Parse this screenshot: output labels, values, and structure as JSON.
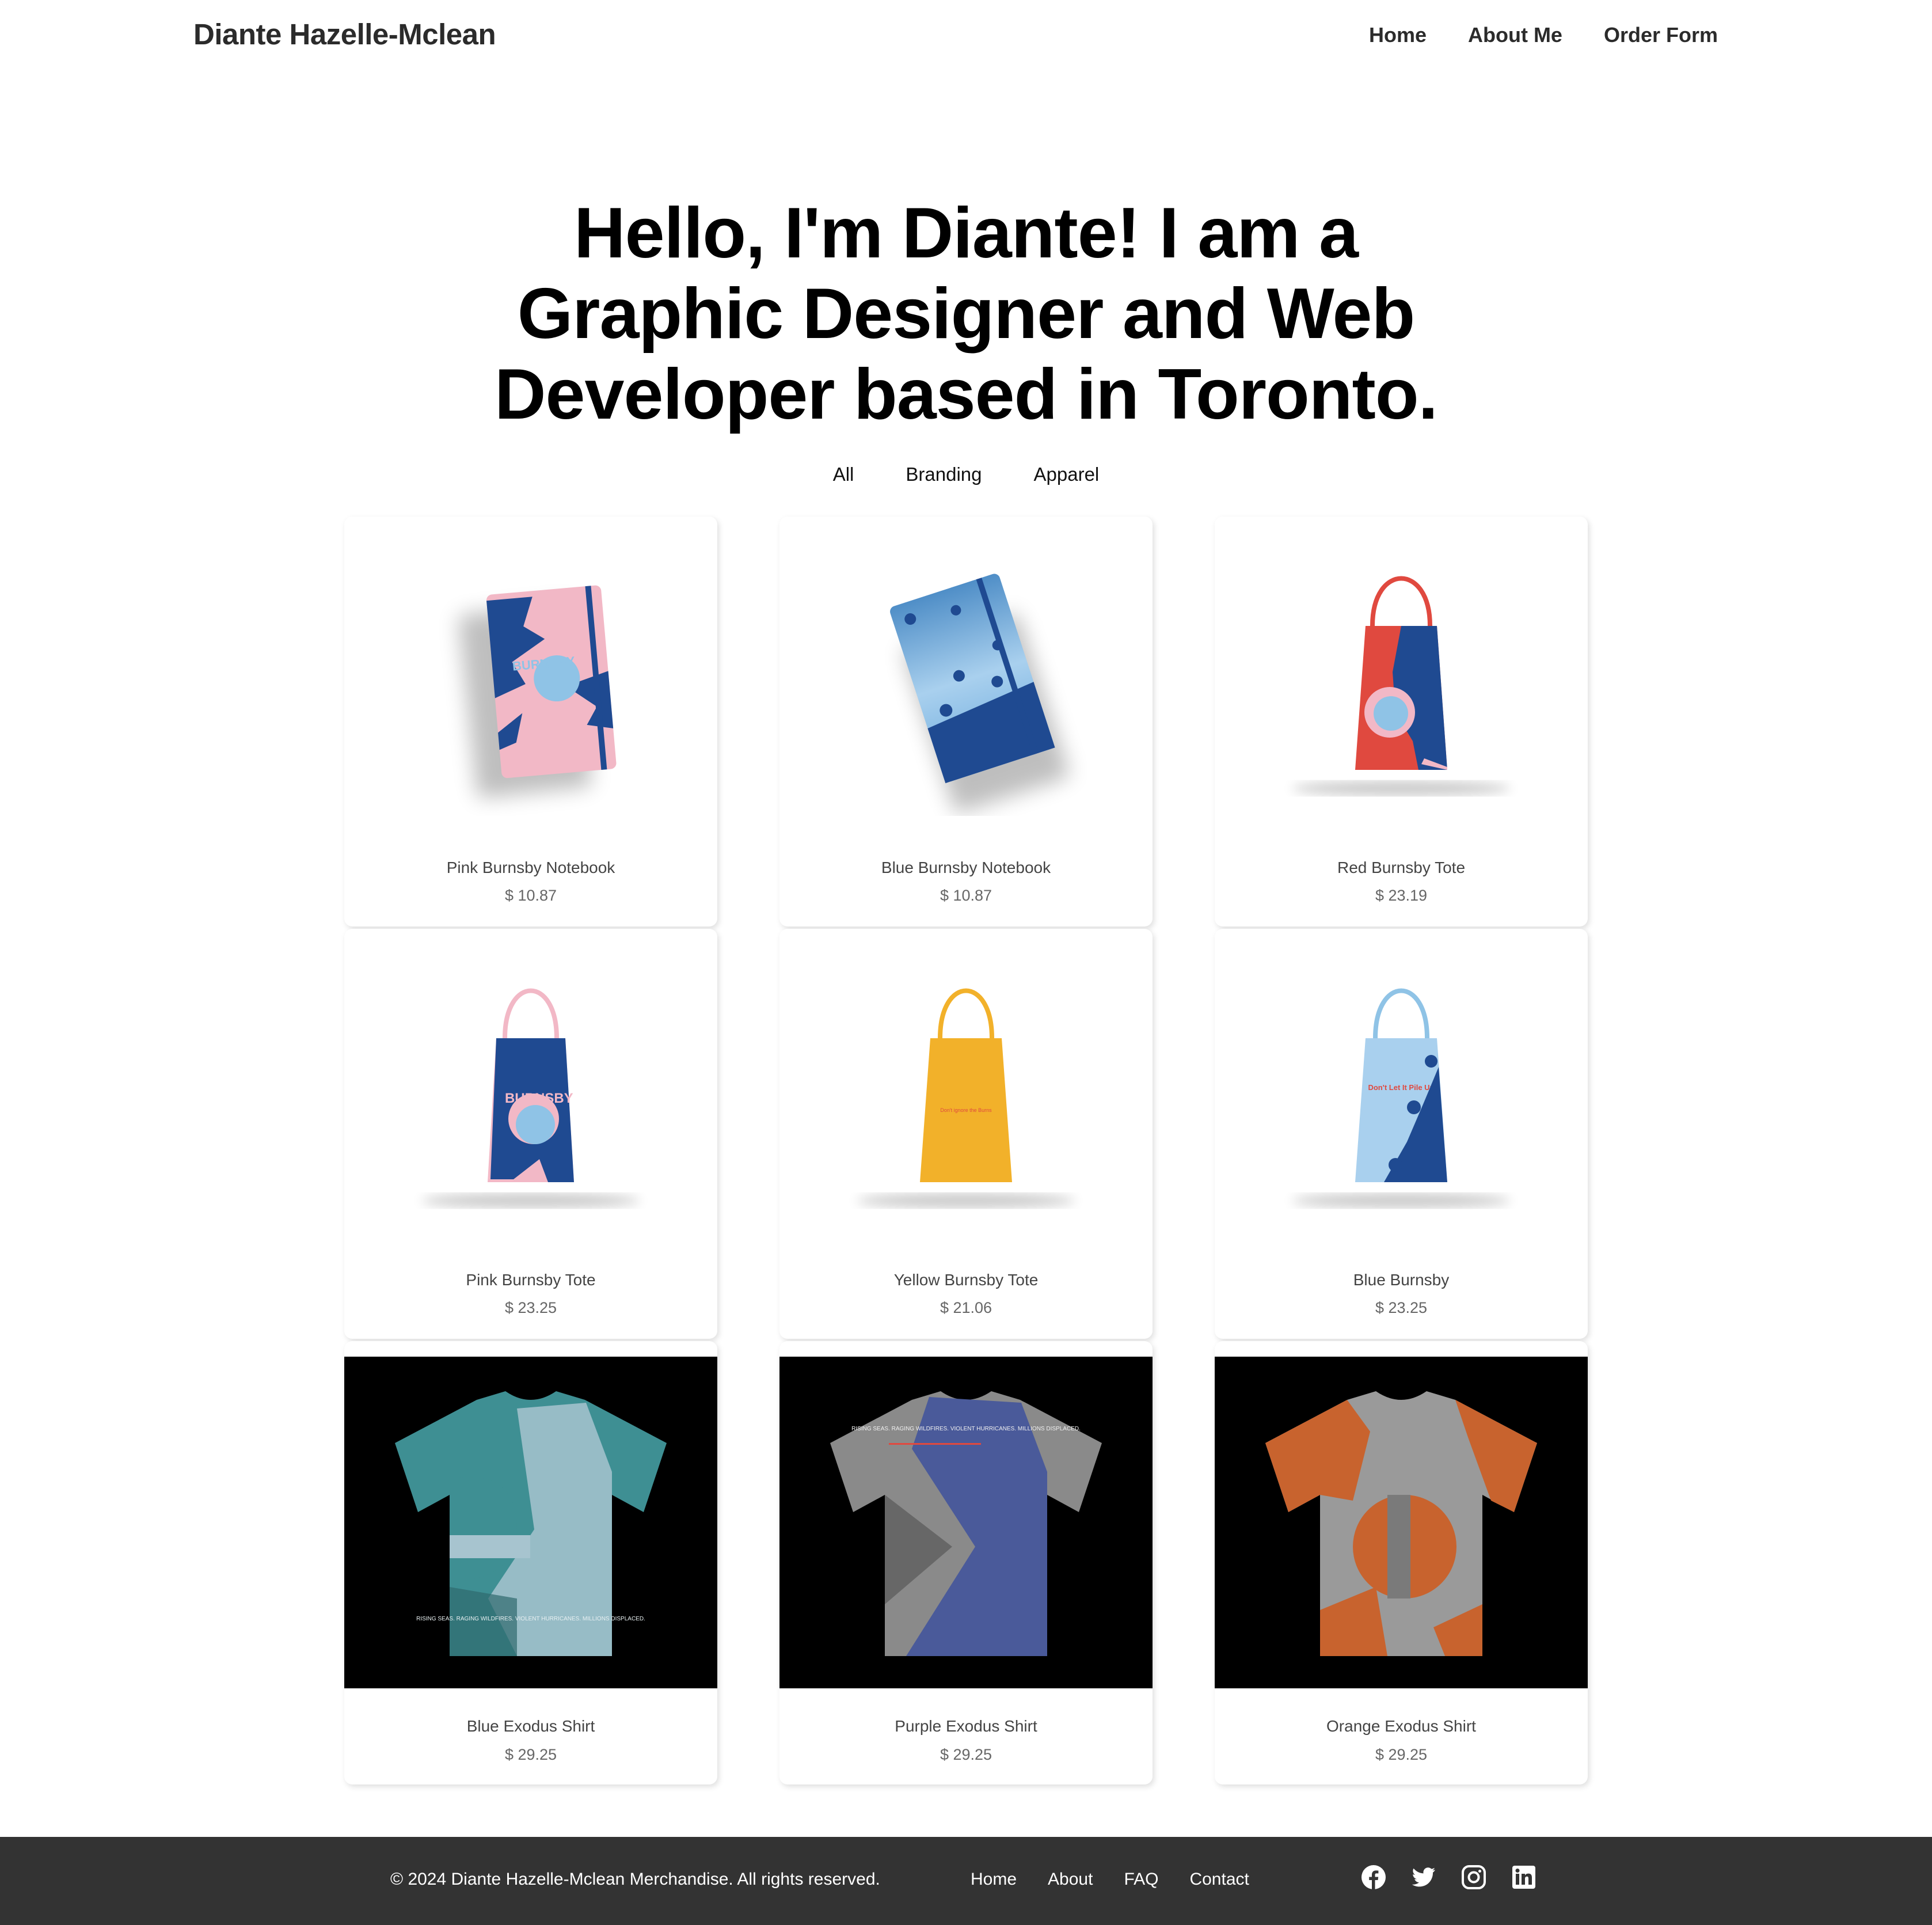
{
  "header": {
    "brand": "Diante Hazelle-Mclean",
    "nav": [
      "Home",
      "About Me",
      "Order Form"
    ]
  },
  "hero": {
    "headline": "Hello, I'm Diante! I am a Graphic Designer and Web Developer based in Toronto."
  },
  "filters": [
    "All",
    "Branding",
    "Apparel"
  ],
  "products": [
    {
      "name": "Pink Burnsby Notebook",
      "price": "$ 10.87"
    },
    {
      "name": "Blue Burnsby Notebook",
      "price": "$ 10.87"
    },
    {
      "name": "Red Burnsby Tote",
      "price": "$ 23.19"
    },
    {
      "name": "Pink Burnsby Tote",
      "price": "$ 23.25"
    },
    {
      "name": "Yellow Burnsby Tote",
      "price": "$ 21.06"
    },
    {
      "name": "Blue Burnsby",
      "price": "$ 23.25"
    },
    {
      "name": "Blue Exodus Shirt",
      "price": "$ 29.25"
    },
    {
      "name": "Purple Exodus Shirt",
      "price": "$ 29.25"
    },
    {
      "name": "Orange Exodus Shirt",
      "price": "$ 29.25"
    }
  ],
  "product_art": {
    "notebook_text": "BURNSBY",
    "yellow_tote_text": "Don't ignore the Burns",
    "blue_tote_text": "Don't Let It Pile Up",
    "shirt_text": "RISING SEAS. RAGING WILDFIRES. VIOLENT HURRICANES. MILLIONS DISPLACED."
  },
  "footer": {
    "copyright": "© 2024 Diante Hazelle-Mclean Merchandise. All rights reserved.",
    "links": [
      "Home",
      "About",
      "FAQ",
      "Contact"
    ],
    "social_icons": [
      "facebook-icon",
      "twitter-icon",
      "instagram-icon",
      "linkedin-icon"
    ]
  },
  "colors": {
    "footer_bg": "#333333",
    "text_dark": "#2b2b2b",
    "pink": "#f2b8c6",
    "navy": "#1f4a91",
    "light_blue": "#8fc3e6",
    "red": "#e0493f",
    "yellow": "#f2b12a",
    "teal": "#3e8f93",
    "purple": "#4a5a9a",
    "orange": "#c8632e"
  }
}
